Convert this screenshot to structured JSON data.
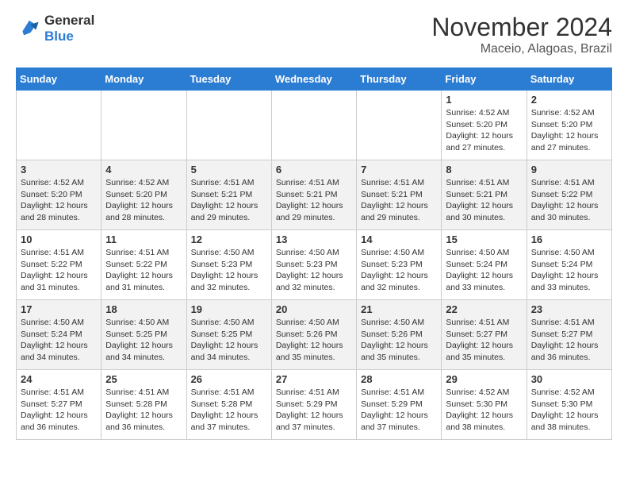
{
  "header": {
    "logo_line1": "General",
    "logo_line2": "Blue",
    "month": "November 2024",
    "location": "Maceio, Alagoas, Brazil"
  },
  "columns": [
    "Sunday",
    "Monday",
    "Tuesday",
    "Wednesday",
    "Thursday",
    "Friday",
    "Saturday"
  ],
  "weeks": [
    [
      {
        "day": "",
        "info": ""
      },
      {
        "day": "",
        "info": ""
      },
      {
        "day": "",
        "info": ""
      },
      {
        "day": "",
        "info": ""
      },
      {
        "day": "",
        "info": ""
      },
      {
        "day": "1",
        "info": "Sunrise: 4:52 AM\nSunset: 5:20 PM\nDaylight: 12 hours\nand 27 minutes."
      },
      {
        "day": "2",
        "info": "Sunrise: 4:52 AM\nSunset: 5:20 PM\nDaylight: 12 hours\nand 27 minutes."
      }
    ],
    [
      {
        "day": "3",
        "info": "Sunrise: 4:52 AM\nSunset: 5:20 PM\nDaylight: 12 hours\nand 28 minutes."
      },
      {
        "day": "4",
        "info": "Sunrise: 4:52 AM\nSunset: 5:20 PM\nDaylight: 12 hours\nand 28 minutes."
      },
      {
        "day": "5",
        "info": "Sunrise: 4:51 AM\nSunset: 5:21 PM\nDaylight: 12 hours\nand 29 minutes."
      },
      {
        "day": "6",
        "info": "Sunrise: 4:51 AM\nSunset: 5:21 PM\nDaylight: 12 hours\nand 29 minutes."
      },
      {
        "day": "7",
        "info": "Sunrise: 4:51 AM\nSunset: 5:21 PM\nDaylight: 12 hours\nand 29 minutes."
      },
      {
        "day": "8",
        "info": "Sunrise: 4:51 AM\nSunset: 5:21 PM\nDaylight: 12 hours\nand 30 minutes."
      },
      {
        "day": "9",
        "info": "Sunrise: 4:51 AM\nSunset: 5:22 PM\nDaylight: 12 hours\nand 30 minutes."
      }
    ],
    [
      {
        "day": "10",
        "info": "Sunrise: 4:51 AM\nSunset: 5:22 PM\nDaylight: 12 hours\nand 31 minutes."
      },
      {
        "day": "11",
        "info": "Sunrise: 4:51 AM\nSunset: 5:22 PM\nDaylight: 12 hours\nand 31 minutes."
      },
      {
        "day": "12",
        "info": "Sunrise: 4:50 AM\nSunset: 5:23 PM\nDaylight: 12 hours\nand 32 minutes."
      },
      {
        "day": "13",
        "info": "Sunrise: 4:50 AM\nSunset: 5:23 PM\nDaylight: 12 hours\nand 32 minutes."
      },
      {
        "day": "14",
        "info": "Sunrise: 4:50 AM\nSunset: 5:23 PM\nDaylight: 12 hours\nand 32 minutes."
      },
      {
        "day": "15",
        "info": "Sunrise: 4:50 AM\nSunset: 5:24 PM\nDaylight: 12 hours\nand 33 minutes."
      },
      {
        "day": "16",
        "info": "Sunrise: 4:50 AM\nSunset: 5:24 PM\nDaylight: 12 hours\nand 33 minutes."
      }
    ],
    [
      {
        "day": "17",
        "info": "Sunrise: 4:50 AM\nSunset: 5:24 PM\nDaylight: 12 hours\nand 34 minutes."
      },
      {
        "day": "18",
        "info": "Sunrise: 4:50 AM\nSunset: 5:25 PM\nDaylight: 12 hours\nand 34 minutes."
      },
      {
        "day": "19",
        "info": "Sunrise: 4:50 AM\nSunset: 5:25 PM\nDaylight: 12 hours\nand 34 minutes."
      },
      {
        "day": "20",
        "info": "Sunrise: 4:50 AM\nSunset: 5:26 PM\nDaylight: 12 hours\nand 35 minutes."
      },
      {
        "day": "21",
        "info": "Sunrise: 4:50 AM\nSunset: 5:26 PM\nDaylight: 12 hours\nand 35 minutes."
      },
      {
        "day": "22",
        "info": "Sunrise: 4:51 AM\nSunset: 5:27 PM\nDaylight: 12 hours\nand 35 minutes."
      },
      {
        "day": "23",
        "info": "Sunrise: 4:51 AM\nSunset: 5:27 PM\nDaylight: 12 hours\nand 36 minutes."
      }
    ],
    [
      {
        "day": "24",
        "info": "Sunrise: 4:51 AM\nSunset: 5:27 PM\nDaylight: 12 hours\nand 36 minutes."
      },
      {
        "day": "25",
        "info": "Sunrise: 4:51 AM\nSunset: 5:28 PM\nDaylight: 12 hours\nand 36 minutes."
      },
      {
        "day": "26",
        "info": "Sunrise: 4:51 AM\nSunset: 5:28 PM\nDaylight: 12 hours\nand 37 minutes."
      },
      {
        "day": "27",
        "info": "Sunrise: 4:51 AM\nSunset: 5:29 PM\nDaylight: 12 hours\nand 37 minutes."
      },
      {
        "day": "28",
        "info": "Sunrise: 4:51 AM\nSunset: 5:29 PM\nDaylight: 12 hours\nand 37 minutes."
      },
      {
        "day": "29",
        "info": "Sunrise: 4:52 AM\nSunset: 5:30 PM\nDaylight: 12 hours\nand 38 minutes."
      },
      {
        "day": "30",
        "info": "Sunrise: 4:52 AM\nSunset: 5:30 PM\nDaylight: 12 hours\nand 38 minutes."
      }
    ]
  ]
}
